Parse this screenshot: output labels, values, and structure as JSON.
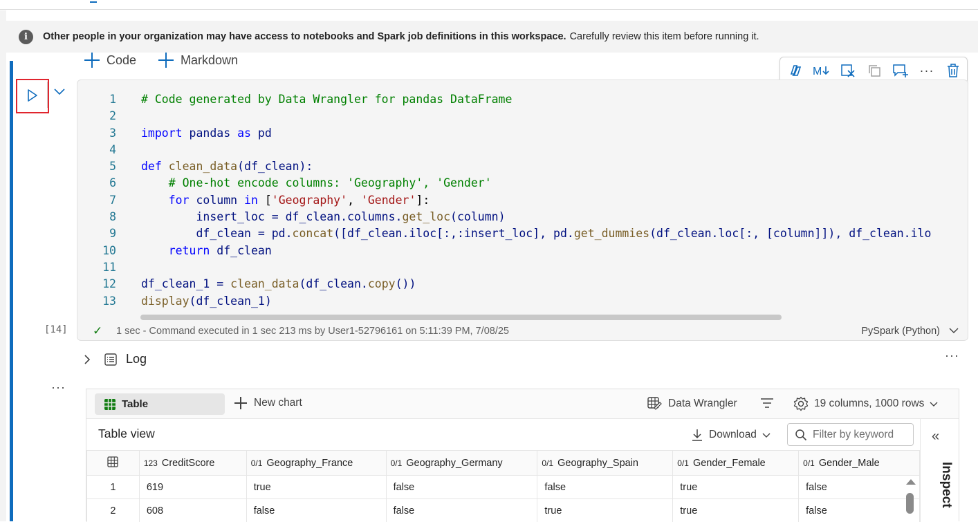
{
  "banner": {
    "bold_text": "Other people in your organization may have access to notebooks and Spark job definitions in this workspace.",
    "rest_text": "Carefully review this item before running it."
  },
  "add_row": {
    "code_label": "Code",
    "markdown_label": "Markdown"
  },
  "cell": {
    "execution_count": "[14]",
    "code_lines": [
      {
        "n": "1"
      },
      {
        "n": "2"
      },
      {
        "n": "3"
      },
      {
        "n": "4"
      },
      {
        "n": "5"
      },
      {
        "n": "6"
      },
      {
        "n": "7"
      },
      {
        "n": "8"
      },
      {
        "n": "9"
      },
      {
        "n": "10"
      },
      {
        "n": "11"
      },
      {
        "n": "12"
      },
      {
        "n": "13"
      }
    ],
    "code": {
      "l1": "# Code generated by Data Wrangler for pandas DataFrame",
      "l3_import": "import",
      "l3_mod": " pandas ",
      "l3_as": "as",
      "l3_alias": " pd",
      "l5_def": "def",
      "l5_fn": " clean_data",
      "l5_rest": "(df_clean):",
      "l6": "    # One-hot encode columns: 'Geography', 'Gender'",
      "l7_for": "    for",
      "l7_var": " column ",
      "l7_in": "in",
      "l7_open": " [",
      "l7_s1": "'Geography'",
      "l7_comma": ", ",
      "l7_s2": "'Gender'",
      "l7_close": "]:",
      "l8_a": "        insert_loc = df_clean.columns.",
      "l8_fn": "get_loc",
      "l8_b": "(column)",
      "l9_a": "        df_clean = pd.",
      "l9_fn1": "concat",
      "l9_b": "([df_clean.iloc[:,:insert_loc], pd.",
      "l9_fn2": "get_dummies",
      "l9_c": "(df_clean.loc[:, [column]]), df_clean.ilo",
      "l10_kw": "    return",
      "l10_rest": " df_clean",
      "l12_a": "df_clean_1 = ",
      "l12_fn": "clean_data",
      "l12_b": "(df_clean.",
      "l12_fn2": "copy",
      "l12_c": "())",
      "l13_fn": "display",
      "l13_b": "(df_clean_1)"
    },
    "status_message": "1 sec - Command executed in 1 sec 213 ms by User1-52796161 on 5:11:39 PM, 7/08/25",
    "language": "PySpark (Python)"
  },
  "log_label": "Log",
  "output": {
    "tab_table": "Table",
    "new_chart": "New chart",
    "data_wrangler": "Data Wrangler",
    "columns_rows": "19 columns, 1000 rows",
    "table_view_title": "Table view",
    "download": "Download",
    "filter_placeholder": "Filter by keyword",
    "inspect_label": "Inspect",
    "columns": [
      {
        "prefix": "123",
        "name": "CreditScore"
      },
      {
        "prefix": "0/1",
        "name": "Geography_France"
      },
      {
        "prefix": "0/1",
        "name": "Geography_Germany"
      },
      {
        "prefix": "0/1",
        "name": "Geography_Spain"
      },
      {
        "prefix": "0/1",
        "name": "Gender_Female"
      },
      {
        "prefix": "0/1",
        "name": "Gender_Male"
      }
    ],
    "rows": [
      {
        "idx": "1",
        "cells": [
          "619",
          "true",
          "false",
          "false",
          "true",
          "false"
        ]
      },
      {
        "idx": "2",
        "cells": [
          "608",
          "false",
          "false",
          "true",
          "true",
          "false"
        ]
      }
    ]
  },
  "colors": {
    "accent": "#0f6cbd",
    "run_highlight": "#e0252e",
    "success": "#107c10"
  },
  "icons": [
    "info-icon",
    "plus-icon",
    "copilot-icon",
    "markdown-toggle-icon",
    "clear-output-icon",
    "copy-cell-icon",
    "comment-icon",
    "more-icon",
    "delete-icon",
    "play-icon",
    "chevron-down-icon",
    "check-icon",
    "chevron-right-icon",
    "log-icon",
    "table-grid-icon",
    "data-wrangler-icon",
    "filter-icon",
    "settings-icon",
    "download-icon",
    "search-icon",
    "collapse-left-icon"
  ]
}
